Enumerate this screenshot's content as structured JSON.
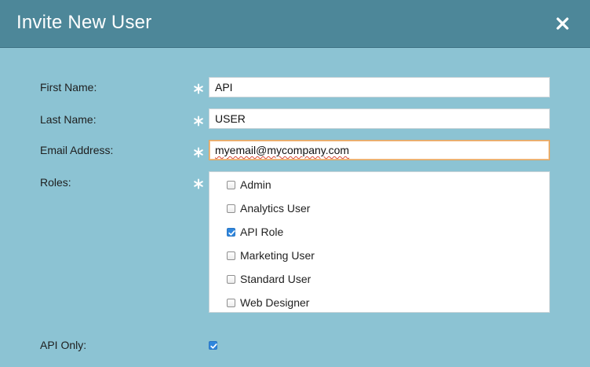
{
  "dialog": {
    "title": "Invite New User",
    "close_icon": "close-icon"
  },
  "form": {
    "first_name": {
      "label": "First Name:",
      "value": "API",
      "required": true
    },
    "last_name": {
      "label": "Last Name:",
      "value": "USER",
      "required": true
    },
    "email": {
      "label": "Email Address:",
      "value": "myemail@mycompany.com",
      "required": true
    },
    "roles": {
      "label": "Roles:",
      "required": true,
      "items": [
        {
          "label": "Admin",
          "checked": false
        },
        {
          "label": "Analytics User",
          "checked": false
        },
        {
          "label": "API Role",
          "checked": true
        },
        {
          "label": "Marketing User",
          "checked": false
        },
        {
          "label": "Standard User",
          "checked": false
        },
        {
          "label": "Web Designer",
          "checked": false
        }
      ]
    },
    "api_only": {
      "label": "API Only:",
      "checked": true
    }
  },
  "colors": {
    "titlebar": "#4d8799",
    "body": "#8cc3d3",
    "required_asterisk": "#ffffff",
    "checkbox_checked": "#2f86dd",
    "focus_border": "#e7a45b"
  }
}
